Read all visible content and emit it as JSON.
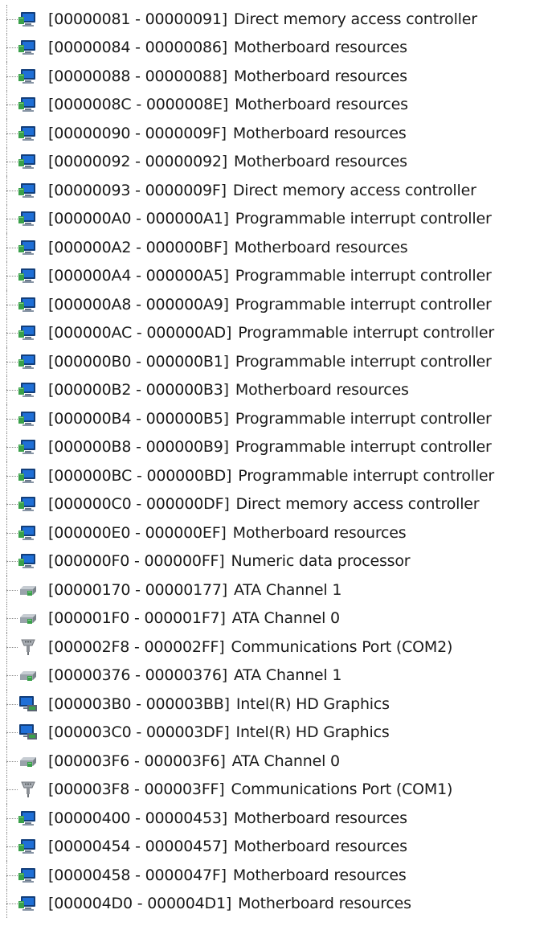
{
  "device_manager_io_list": {
    "items": [
      {
        "range": "[00000081 - 00000091]",
        "name": "Direct memory access controller",
        "icon": "system-device-icon"
      },
      {
        "range": "[00000084 - 00000086]",
        "name": "Motherboard resources",
        "icon": "system-device-icon"
      },
      {
        "range": "[00000088 - 00000088]",
        "name": "Motherboard resources",
        "icon": "system-device-icon"
      },
      {
        "range": "[0000008C - 0000008E]",
        "name": "Motherboard resources",
        "icon": "system-device-icon"
      },
      {
        "range": "[00000090 - 0000009F]",
        "name": "Motherboard resources",
        "icon": "system-device-icon"
      },
      {
        "range": "[00000092 - 00000092]",
        "name": "Motherboard resources",
        "icon": "system-device-icon"
      },
      {
        "range": "[00000093 - 0000009F]",
        "name": "Direct memory access controller",
        "icon": "system-device-icon"
      },
      {
        "range": "[000000A0 - 000000A1]",
        "name": "Programmable interrupt controller",
        "icon": "system-device-icon"
      },
      {
        "range": "[000000A2 - 000000BF]",
        "name": "Motherboard resources",
        "icon": "system-device-icon"
      },
      {
        "range": "[000000A4 - 000000A5]",
        "name": "Programmable interrupt controller",
        "icon": "system-device-icon"
      },
      {
        "range": "[000000A8 - 000000A9]",
        "name": "Programmable interrupt controller",
        "icon": "system-device-icon"
      },
      {
        "range": "[000000AC - 000000AD]",
        "name": "Programmable interrupt controller",
        "icon": "system-device-icon"
      },
      {
        "range": "[000000B0 - 000000B1]",
        "name": "Programmable interrupt controller",
        "icon": "system-device-icon"
      },
      {
        "range": "[000000B2 - 000000B3]",
        "name": "Motherboard resources",
        "icon": "system-device-icon"
      },
      {
        "range": "[000000B4 - 000000B5]",
        "name": "Programmable interrupt controller",
        "icon": "system-device-icon"
      },
      {
        "range": "[000000B8 - 000000B9]",
        "name": "Programmable interrupt controller",
        "icon": "system-device-icon"
      },
      {
        "range": "[000000BC - 000000BD]",
        "name": "Programmable interrupt controller",
        "icon": "system-device-icon"
      },
      {
        "range": "[000000C0 - 000000DF]",
        "name": "Direct memory access controller",
        "icon": "system-device-icon"
      },
      {
        "range": "[000000E0 - 000000EF]",
        "name": "Motherboard resources",
        "icon": "system-device-icon"
      },
      {
        "range": "[000000F0 - 000000FF]",
        "name": "Numeric data processor",
        "icon": "system-device-icon"
      },
      {
        "range": "[00000170 - 00000177]",
        "name": "ATA Channel 1",
        "icon": "ide-controller-icon"
      },
      {
        "range": "[000001F0 - 000001F7]",
        "name": "ATA Channel 0",
        "icon": "ide-controller-icon"
      },
      {
        "range": "[000002F8 - 000002FF]",
        "name": "Communications Port (COM2)",
        "icon": "serial-port-icon"
      },
      {
        "range": "[00000376 - 00000376]",
        "name": "ATA Channel 1",
        "icon": "ide-controller-icon"
      },
      {
        "range": "[000003B0 - 000003BB]",
        "name": "Intel(R) HD Graphics",
        "icon": "display-adapter-icon"
      },
      {
        "range": "[000003C0 - 000003DF]",
        "name": "Intel(R) HD Graphics",
        "icon": "display-adapter-icon"
      },
      {
        "range": "[000003F6 - 000003F6]",
        "name": "ATA Channel 0",
        "icon": "ide-controller-icon"
      },
      {
        "range": "[000003F8 - 000003FF]",
        "name": "Communications Port (COM1)",
        "icon": "serial-port-icon"
      },
      {
        "range": "[00000400 - 00000453]",
        "name": "Motherboard resources",
        "icon": "system-device-icon"
      },
      {
        "range": "[00000454 - 00000457]",
        "name": "Motherboard resources",
        "icon": "system-device-icon"
      },
      {
        "range": "[00000458 - 0000047F]",
        "name": "Motherboard resources",
        "icon": "system-device-icon"
      },
      {
        "range": "[000004D0 - 000004D1]",
        "name": "Motherboard resources",
        "icon": "system-device-icon"
      }
    ]
  },
  "colors": {
    "monitor_blue": "#1f6fd6",
    "monitor_dark": "#123e7a",
    "chip_green": "#3aa04a",
    "drive_gray": "#9aa3ab",
    "port_gray": "#8c9096",
    "tree_line": "#8a8a8a"
  }
}
